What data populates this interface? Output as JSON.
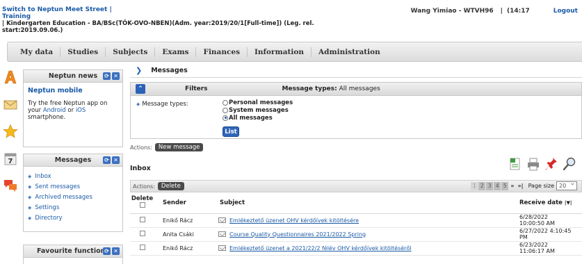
{
  "header": {
    "switch_link": "Switch to Neptun Meet Street |",
    "training_link": "Training",
    "program": "| Kindergarten Education - BA/BSc(TÓK-OVO-NBEN)(Adm. year:2019/20/1[Full-time]) (Leg. rel. start:2019.09.06.)",
    "user": "Wang Yimiao - WTVH96",
    "sep": "|",
    "clock": "(14:17",
    "logout": "Logout"
  },
  "menu": [
    "My data",
    "Studies",
    "Subjects",
    "Exams",
    "Finances",
    "Information",
    "Administration"
  ],
  "news_box": {
    "title": "Neptun news",
    "item_title": "Neptun mobile",
    "text_before": "Try the free Neptun app on your ",
    "link_android": "Android",
    "text_or": " or ",
    "link_ios": "iOS",
    "text_after": " smartphone."
  },
  "messages_box": {
    "title": "Messages",
    "items": [
      "Inbox",
      "Sent messages",
      "Archived messages",
      "Settings",
      "Directory"
    ]
  },
  "favourite_box": {
    "title": "Favourite functions"
  },
  "main": {
    "crumb": "Messages",
    "filters_label": "Filters",
    "types_label": "Message types:",
    "types_value": "All messages",
    "filter_field": "Message types:",
    "radio_options": [
      "Personal messages",
      "System messages",
      "All messages"
    ],
    "radio_selected": 2,
    "list_button": "List",
    "actions_label": "Actions:",
    "new_message_button": "New message",
    "inbox_title": "Inbox",
    "actions2_label": "Actions:",
    "delete_button": "Delete",
    "pages": [
      "1",
      "2",
      "3",
      "4",
      "5"
    ],
    "pager_next": "»",
    "pager_last": "»|",
    "page_size_label": "Page size",
    "page_size_value": "20"
  },
  "table": {
    "columns": {
      "delete": "Delete",
      "sender": "Sender",
      "subject": "Subject",
      "date": "Receive date"
    },
    "rows": [
      {
        "sender": "Enikő Rácz",
        "subject": "Emlékeztető üzenet OHV kérdőívek kitöltésére",
        "date1": "6/28/2022",
        "date2": "10:00:50 AM"
      },
      {
        "sender": "Anita Csáki",
        "subject": "Course Quality Questionnaires 2021/2022 Spring",
        "date1": "6/27/2022 4:10:45",
        "date2": "PM"
      },
      {
        "sender": "Enikő Rácz",
        "subject": "Emlékeztető üzenet a 2021/22/2 félév OHV kérdőívek kitöltéséről",
        "date1": "6/23/2022",
        "date2": "11:06:17 AM"
      }
    ]
  }
}
